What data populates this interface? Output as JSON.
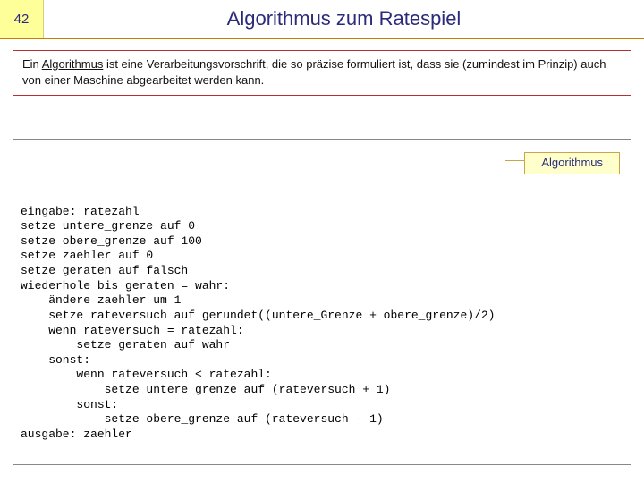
{
  "header": {
    "page_number": "42",
    "title": "Algorithmus zum Ratespiel"
  },
  "definition": {
    "prefix": "Ein ",
    "term": "Algorithmus",
    "rest": " ist eine Verarbeitungsvorschrift, die so präzise formuliert ist, dass sie (zumindest im Prinzip) auch von einer Maschine abgearbeitet werden kann."
  },
  "algorithm": {
    "label": "Algorithmus",
    "code": "eingabe: ratezahl\nsetze untere_grenze auf 0\nsetze obere_grenze auf 100\nsetze zaehler auf 0\nsetze geraten auf falsch\nwiederhole bis geraten = wahr:\n    ändere zaehler um 1\n    setze rateversuch auf gerundet((untere_Grenze + obere_grenze)/2)\n    wenn rateversuch = ratezahl:\n        setze geraten auf wahr\n    sonst:\n        wenn rateversuch < ratezahl:\n            setze untere_grenze auf (rateversuch + 1)\n        sonst:\n            setze obere_grenze auf (rateversuch - 1)\nausgabe: zaehler"
  }
}
